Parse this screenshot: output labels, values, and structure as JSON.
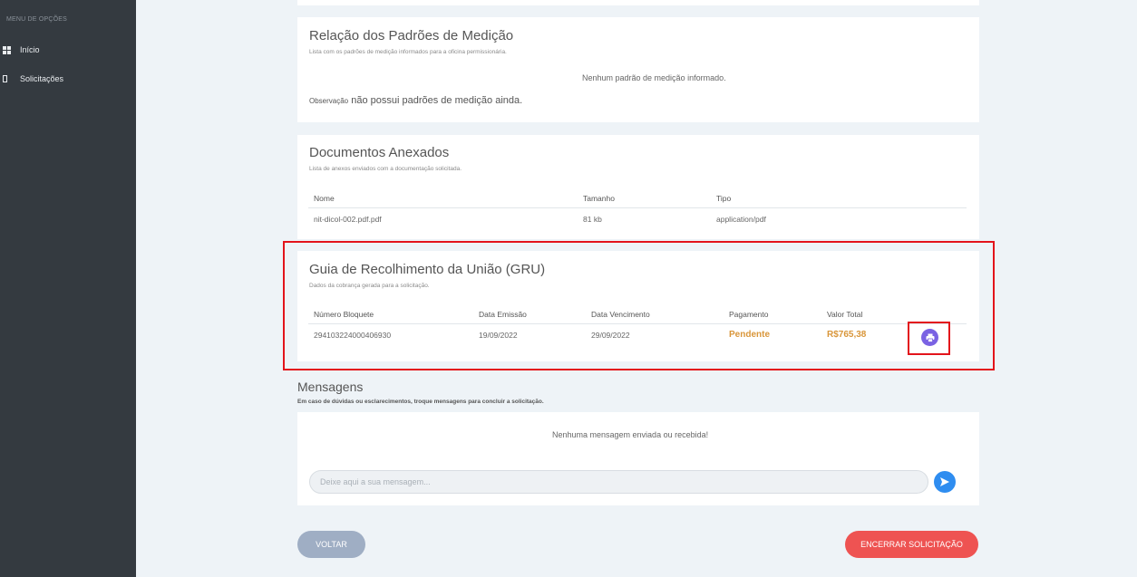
{
  "sidebar": {
    "title": "MENU DE OPÇÕES",
    "items": [
      {
        "label": "Início",
        "icon": "dashboard-icon"
      },
      {
        "label": "Solicitações",
        "icon": "document-icon"
      }
    ]
  },
  "padroes": {
    "title": "Relação dos Padrões de Medição",
    "subtitle": "Lista com os padrões de medição informados para a oficina permissionária.",
    "empty": "Nenhum padrão de medição informado.",
    "obs_label": "Observação",
    "obs_text": "não possui padrões de medição ainda."
  },
  "anexos": {
    "title": "Documentos Anexados",
    "subtitle": "Lista de anexos enviados com a documentação solicitada.",
    "headers": [
      "Nome",
      "Tamanho",
      "Tipo"
    ],
    "rows": [
      {
        "nome": "nit-dicol-002.pdf.pdf",
        "tamanho": "81 kb",
        "tipo": "application/pdf"
      }
    ]
  },
  "gru": {
    "title": "Guia de Recolhimento da União (GRU)",
    "subtitle": "Dados da cobrança gerada para a solicitação.",
    "headers": [
      "Número Bloquete",
      "Data Emissão",
      "Data Vencimento",
      "Pagamento",
      "Valor Total"
    ],
    "rows": [
      {
        "numero": "294103224000406930",
        "emissao": "19/09/2022",
        "vencimento": "29/09/2022",
        "pagamento": "Pendente",
        "valor": "R$765,38"
      }
    ],
    "status_color": "#d9963a"
  },
  "mensagens": {
    "title": "Mensagens",
    "subtitle": "Em caso de dúvidas ou esclarecimentos, troque mensagens para concluir a solicitação.",
    "empty": "Nenhuma mensagem enviada ou recebida!",
    "placeholder": "Deixe aqui a sua mensagem..."
  },
  "actions": {
    "back": "VOLTAR",
    "close": "ENCERRAR SOLICITAÇÃO"
  },
  "colors": {
    "sidebar_bg": "#343a40",
    "accent_purple": "#7a62e3",
    "send_blue": "#2f8df0",
    "danger": "#ee5352",
    "highlight": "#e3141b"
  }
}
